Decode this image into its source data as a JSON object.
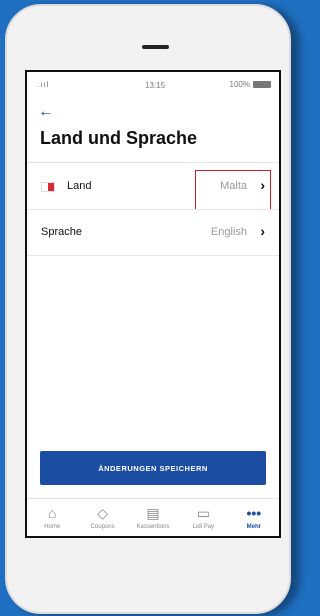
{
  "status_bar": {
    "signal": ".ııl",
    "time": "13:15",
    "battery": "100%"
  },
  "header": {
    "back_icon": "arrow-left-icon",
    "title": "Land und Sprache"
  },
  "settings": {
    "country": {
      "label": "Land",
      "value": "Malta",
      "flag_icon": "malta-flag-icon"
    },
    "language": {
      "label": "Sprache",
      "value": "English"
    }
  },
  "save_button": {
    "label": "ÄNDERUNGEN SPEICHERN"
  },
  "tabs": [
    {
      "label": "Home",
      "icon": "home-icon"
    },
    {
      "label": "Coupons",
      "icon": "coupon-icon"
    },
    {
      "label": "Kassenbons",
      "icon": "receipt-icon"
    },
    {
      "label": "Lidl Pay",
      "icon": "wallet-icon"
    },
    {
      "label": "Mehr",
      "icon": "more-icon"
    }
  ],
  "colors": {
    "primary": "#1b4ea3",
    "highlight": "#d11f2a",
    "background": "#1f6fc2"
  }
}
